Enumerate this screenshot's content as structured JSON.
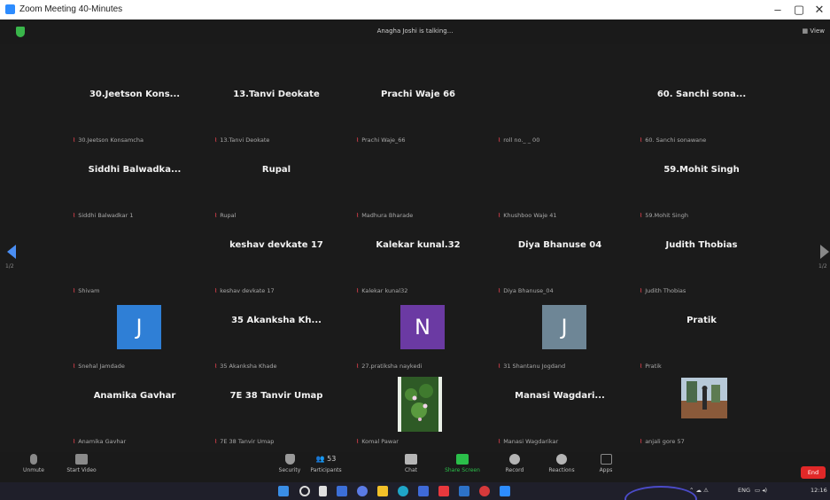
{
  "window": {
    "title": "Zoom Meeting 40-Minutes",
    "minimize": "–",
    "maximize": "▢",
    "close": "✕"
  },
  "header": {
    "talking": "Anagha Joshi is talking...",
    "view": "View"
  },
  "nav": {
    "page_left": "1/2",
    "page_right": "1/2"
  },
  "colors": {
    "mic_muted": "#e0414d",
    "end_button": "#e02828",
    "share_screen": "#2bbf4a",
    "nav_arrow": "#4a8ef3"
  },
  "tiles": [
    {
      "display": "30.Jeetson Kons...",
      "label": "30.Jeetson Konsamcha"
    },
    {
      "display": "13.Tanvi Deokate",
      "label": "13.Tanvi Deokate"
    },
    {
      "display": "Prachi Waje 66",
      "label": "Prachi Waje_66"
    },
    {
      "display": "",
      "label": "roll no._ _  00"
    },
    {
      "display": "60. Sanchi sona...",
      "label": "60. Sanchi sonawane"
    },
    {
      "display": "Siddhi Balwadka...",
      "label": "Siddhi Balwadkar 1"
    },
    {
      "display": "Rupal",
      "label": "Rupal"
    },
    {
      "display": "",
      "label": "Madhura Bharade"
    },
    {
      "display": "",
      "label": "Khushboo Waje 41"
    },
    {
      "display": "59.Mohit Singh",
      "label": "59.Mohit Singh"
    },
    {
      "display": "",
      "label": "Shivam"
    },
    {
      "display": "keshav devkate 17",
      "label": "keshav devkate 17"
    },
    {
      "display": "Kalekar kunal.32",
      "label": "Kalekar kunal32"
    },
    {
      "display": "Diya Bhanuse 04",
      "label": "Diya Bhanuse_04"
    },
    {
      "display": "Judith Thobias",
      "label": "Judith Thobias"
    },
    {
      "display": "",
      "avatar": "J",
      "avatar_color": "#2f7fd6",
      "label": "Snehal Jamdade"
    },
    {
      "display": "35 Akanksha Kh...",
      "label": "35 Akanksha Khade"
    },
    {
      "display": "",
      "avatar": "N",
      "avatar_color": "#6b3aa3",
      "label": "27.pratiksha naykedi"
    },
    {
      "display": "",
      "avatar": "J",
      "avatar_color": "#6e8696",
      "label": "31 Shantanu Jogdand"
    },
    {
      "display": "Pratik",
      "label": "Pratik"
    },
    {
      "display": "Anamika Gavhar",
      "label": "Anamika Gavhar"
    },
    {
      "display": "7E 38 Tanvir Umap",
      "label": "7E 38 Tanvir Umap"
    },
    {
      "display": "",
      "label": "Komal Pawar"
    },
    {
      "display": "Manasi Wagdari...",
      "label": "Manasi Wagdarikar"
    },
    {
      "display": "",
      "label": "anjali gore 57"
    }
  ],
  "toolbar": {
    "unmute": "Unmute",
    "start_video": "Start Video",
    "security": "Security",
    "participants": "Participants",
    "participants_count": "53",
    "chat": "Chat",
    "share_screen": "Share Screen",
    "record": "Record",
    "reactions": "Reactions",
    "apps": "Apps",
    "end": "End"
  },
  "taskbar": {
    "lang": "ENG",
    "time": "12:16"
  }
}
